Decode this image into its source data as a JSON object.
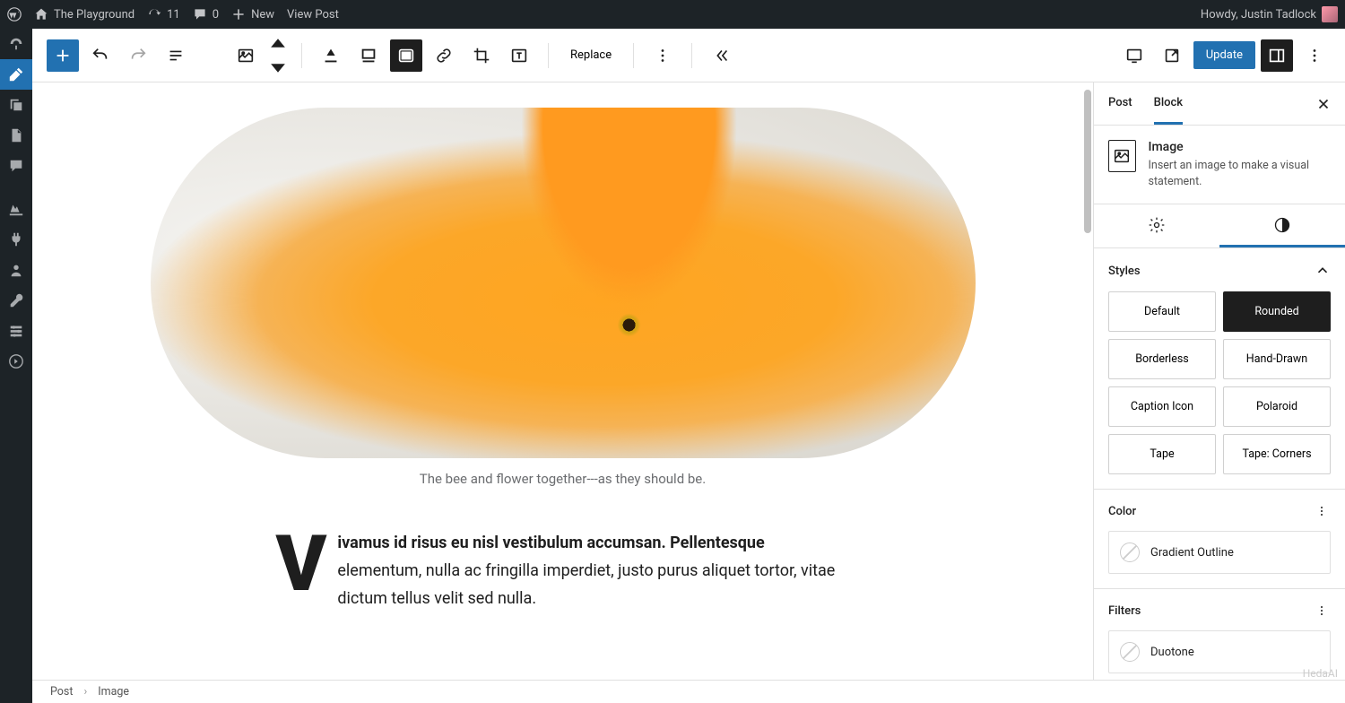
{
  "adminBar": {
    "siteName": "The Playground",
    "updatesCount": "11",
    "commentsCount": "0",
    "newLabel": "New",
    "viewPostLabel": "View Post",
    "howdy": "Howdy, Justin Tadlock"
  },
  "toolbar": {
    "replaceLabel": "Replace",
    "updateLabel": "Update"
  },
  "content": {
    "caption": "The bee and flower together---as they should be.",
    "dropCapLetter": "V",
    "boldLead": "ivamus id risus eu nisl vestibulum accumsan. Pellentesque",
    "bodyRest": " elementum, nulla ac fringilla imperdiet, justo purus aliquet tortor, vitae dictum tellus velit sed nulla."
  },
  "sidebar": {
    "tabs": {
      "post": "Post",
      "block": "Block"
    },
    "block": {
      "title": "Image",
      "desc": "Insert an image to make a visual statement."
    },
    "panels": {
      "styles": "Styles",
      "color": "Color",
      "filters": "Filters"
    },
    "styleOptions": [
      "Default",
      "Rounded",
      "Borderless",
      "Hand-Drawn",
      "Caption Icon",
      "Polaroid",
      "Tape",
      "Tape: Corners"
    ],
    "activeStyle": "Rounded",
    "colorOption": "Gradient Outline",
    "filterOption": "Duotone"
  },
  "breadcrumb": {
    "root": "Post",
    "leaf": "Image"
  },
  "watermark": "HedaAI"
}
